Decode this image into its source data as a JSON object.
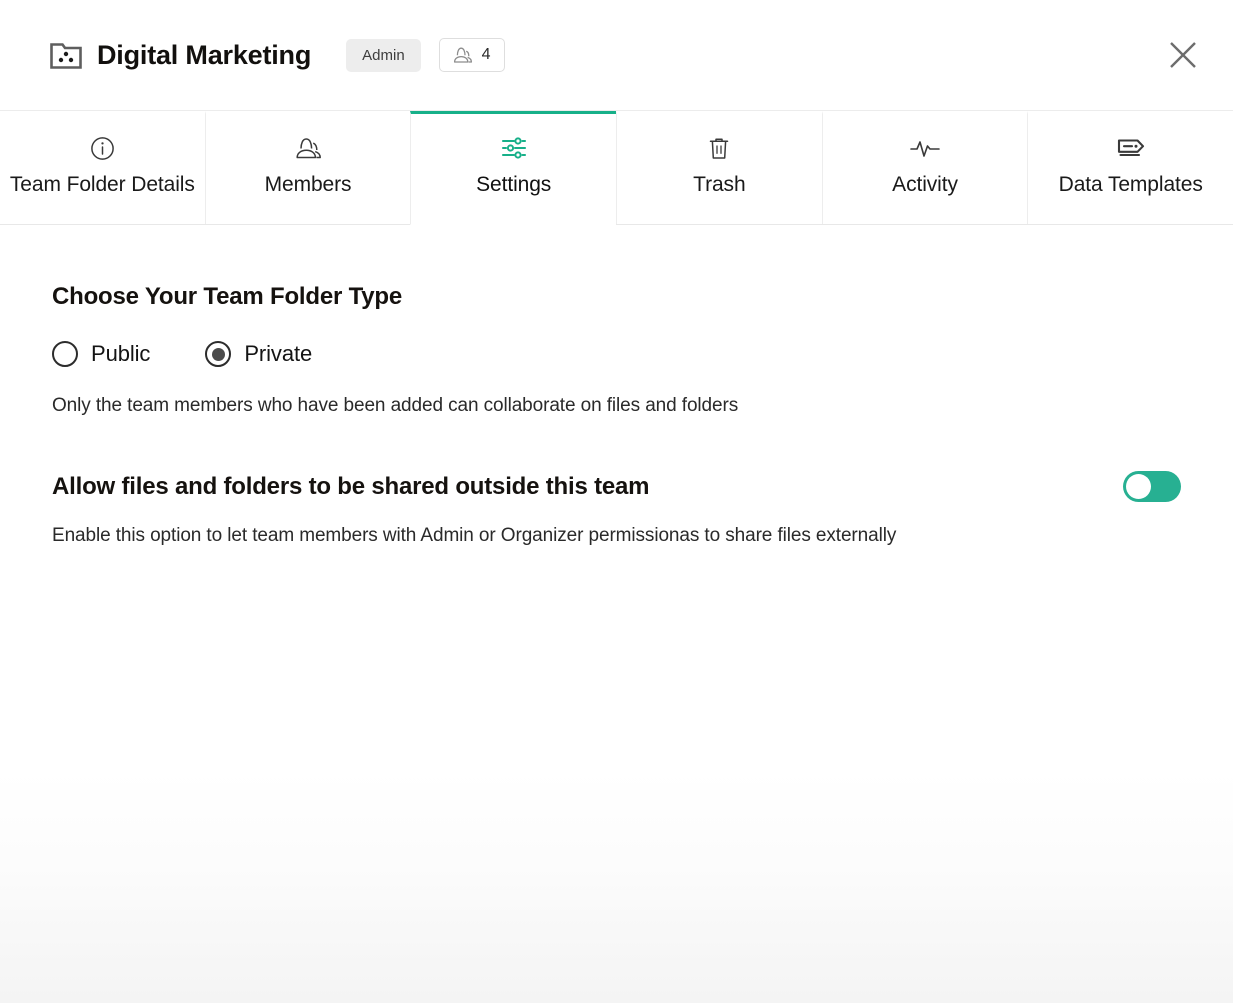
{
  "header": {
    "folder_icon": "team-folder-icon",
    "title": "Digital Marketing",
    "role_badge": "Admin",
    "members_icon": "people-icon",
    "members_count": "4",
    "close_icon": "close-icon"
  },
  "tabs": [
    {
      "label": "Team Folder Details",
      "icon": "info-circle-icon",
      "active": false
    },
    {
      "label": "Members",
      "icon": "people-icon",
      "active": false
    },
    {
      "label": "Settings",
      "icon": "sliders-icon",
      "active": true
    },
    {
      "label": "Trash",
      "icon": "trash-icon",
      "active": false
    },
    {
      "label": "Activity",
      "icon": "pulse-icon",
      "active": false
    },
    {
      "label": "Data Templates",
      "icon": "tag-icon",
      "active": false
    }
  ],
  "main": {
    "folder_type": {
      "title": "Choose Your Team Folder Type",
      "options": [
        {
          "label": "Public",
          "selected": false
        },
        {
          "label": "Private",
          "selected": true
        }
      ],
      "helper_text": "Only the team members who have been added can collaborate on files and folders"
    },
    "external_sharing": {
      "title": "Allow files and folders to be shared outside this team",
      "description": "Enable this option to let team members with Admin or Organizer permissionas to share files externally",
      "toggle_state": "on"
    }
  },
  "colors": {
    "accent_green": "#17b089",
    "toggle_green": "#27b092",
    "badge_gray": "#ededed",
    "text_dark": "#15120f"
  }
}
